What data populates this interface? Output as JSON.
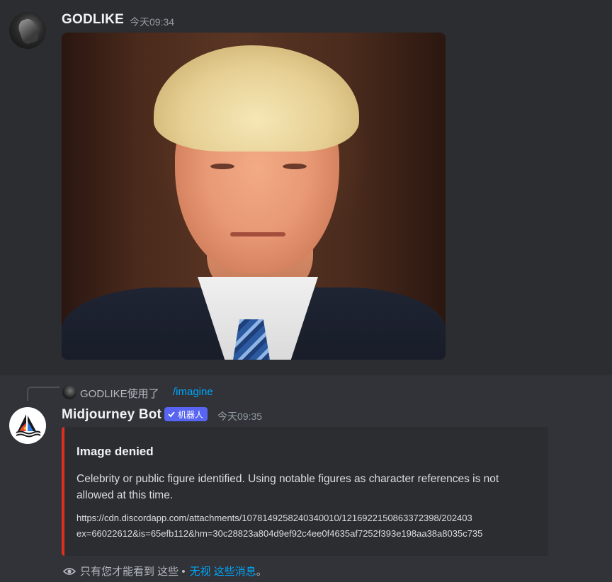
{
  "message1": {
    "username": "GODLIKE",
    "timestamp": "今天09:34"
  },
  "reply": {
    "user_text": "GODLIKE使用了",
    "command": "/imagine"
  },
  "message2": {
    "username": "Midjourney Bot",
    "bot_tag_label": "机器人",
    "timestamp": "今天09:35",
    "embed": {
      "title": "Image denied",
      "description": "Celebrity or public figure identified. Using notable figures as character references is not allowed at this time.",
      "url_line1": "https://cdn.discordapp.com/attachments/1078149258240340010/1216922150863372398/202403",
      "url_line2": "ex=66022612&is=65efb112&hm=30c28823a804d9ef92c4ee0f4635af7252f393e198aa38a8035c735",
      "accent_color": "#dd2e1e"
    }
  },
  "ephemeral": {
    "notice": "只有您才能看到 这些 •",
    "dismiss_link": "无视 这些消息",
    "tail": "。"
  },
  "colors": {
    "background": "#313338",
    "link": "#00a8fc",
    "bot_tag": "#5865f2"
  }
}
